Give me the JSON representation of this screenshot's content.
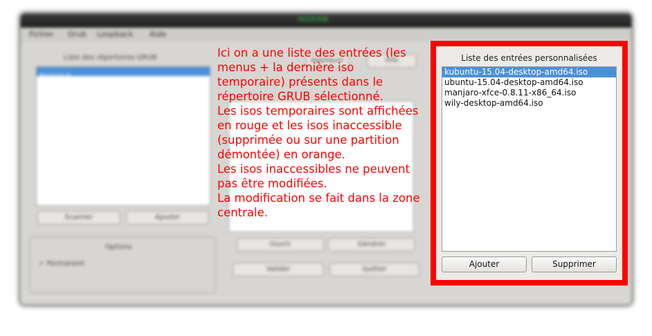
{
  "background_window": {
    "title": "ISO2USB",
    "menu": [
      "Fichier",
      "Grub",
      "Loopback",
      "Aide"
    ],
    "left_list_title": "Liste des répertoires GRUB",
    "left_list_items": [
      "/boot/grub"
    ],
    "scan_button": "Scanner",
    "add_button": "Ajouter",
    "options_title": "Options",
    "permanent_option": "Permanent",
    "center_top_button": "Appliquer",
    "center_top_button2": "Info",
    "open_button": "Ouvrir",
    "generate_button": "Générer",
    "validate_button": "Valider",
    "quit_button": "Quitter"
  },
  "annotation": {
    "paragraphs": [
      "Ici on a une liste des entrées (les menus + la dernière iso temporaire) présents dans le répertoire GRUB sélectionné.",
      "Les isos temporaires sont affichées en rouge et les isos inaccessible (supprimée ou sur une partition démontée) en orange.",
      "Les isos inaccessibles ne peuvent pas être modifiées.",
      "La modification se fait dans la zone centrale."
    ],
    "color": "#ff0000"
  },
  "custom_entries_panel": {
    "title": "Liste des entrées personnalisées",
    "entries": [
      "kubuntu-15.04-desktop-amd64.iso",
      "ubuntu-15.04-desktop-amd64.iso",
      "manjaro-xfce-0.8.11-x86_64.iso",
      "wily-desktop-amd64.iso"
    ],
    "selected_index": 0,
    "add_button": "Ajouter",
    "remove_button": "Supprimer",
    "highlight_color": "#ff0000"
  }
}
